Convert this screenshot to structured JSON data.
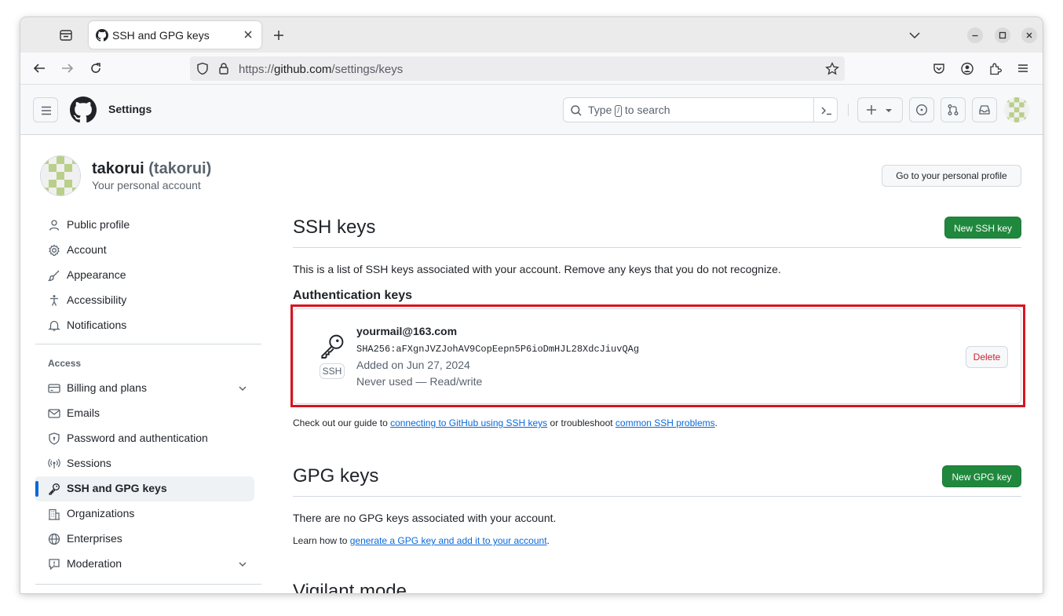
{
  "browser": {
    "tab_title": "SSH and GPG keys",
    "url_prefix": "https://",
    "url_host": "github.com",
    "url_path": "/settings/keys"
  },
  "header": {
    "context": "Settings",
    "search_before": "Type",
    "search_key": "/",
    "search_after": "to search"
  },
  "profile": {
    "name": "takorui",
    "login": "(takorui)",
    "subtitle": "Your personal account",
    "go_profile_label": "Go to your personal profile"
  },
  "sidebar": {
    "items_top": [
      {
        "label": "Public profile",
        "icon": "person-icon"
      },
      {
        "label": "Account",
        "icon": "gear-icon"
      },
      {
        "label": "Appearance",
        "icon": "paintbrush-icon"
      },
      {
        "label": "Accessibility",
        "icon": "accessibility-icon"
      },
      {
        "label": "Notifications",
        "icon": "bell-icon"
      }
    ],
    "access_heading": "Access",
    "items_access": [
      {
        "label": "Billing and plans",
        "icon": "credit-card-icon",
        "expandable": true
      },
      {
        "label": "Emails",
        "icon": "mail-icon"
      },
      {
        "label": "Password and authentication",
        "icon": "shield-lock-icon"
      },
      {
        "label": "Sessions",
        "icon": "broadcast-icon"
      },
      {
        "label": "SSH and GPG keys",
        "icon": "key-icon",
        "active": true
      },
      {
        "label": "Organizations",
        "icon": "organization-icon"
      },
      {
        "label": "Enterprises",
        "icon": "globe-icon"
      },
      {
        "label": "Moderation",
        "icon": "report-icon",
        "expandable": true
      }
    ]
  },
  "ssh": {
    "heading": "SSH keys",
    "new_label": "New SSH key",
    "description": "This is a list of SSH keys associated with your account. Remove any keys that you do not recognize.",
    "auth_heading": "Authentication keys",
    "key": {
      "title": "yourmail@163.com",
      "fingerprint": "SHA256:aFXgnJVZJohAV9CopEepn5P6ioDmHJL28XdcJiuvQAg",
      "added": "Added on Jun 27, 2024",
      "usage": "Never used — Read/write",
      "badge": "SSH",
      "delete_label": "Delete"
    },
    "guide_prefix": "Check out our guide to ",
    "guide_link": "connecting to GitHub using SSH keys",
    "guide_middle": " or troubleshoot ",
    "guide_link2": "common SSH problems",
    "guide_suffix": "."
  },
  "gpg": {
    "heading": "GPG keys",
    "new_label": "New GPG key",
    "empty": "There are no GPG keys associated with your account.",
    "learn_prefix": "Learn how to ",
    "learn_link": "generate a GPG key and add it to your account",
    "learn_suffix": "."
  },
  "vigilant_heading": "Vigilant mode",
  "colors": {
    "primary_green": "#1f883d",
    "link_blue": "#0969da",
    "danger_red": "#d1242f",
    "highlight_red": "#d7141f"
  }
}
